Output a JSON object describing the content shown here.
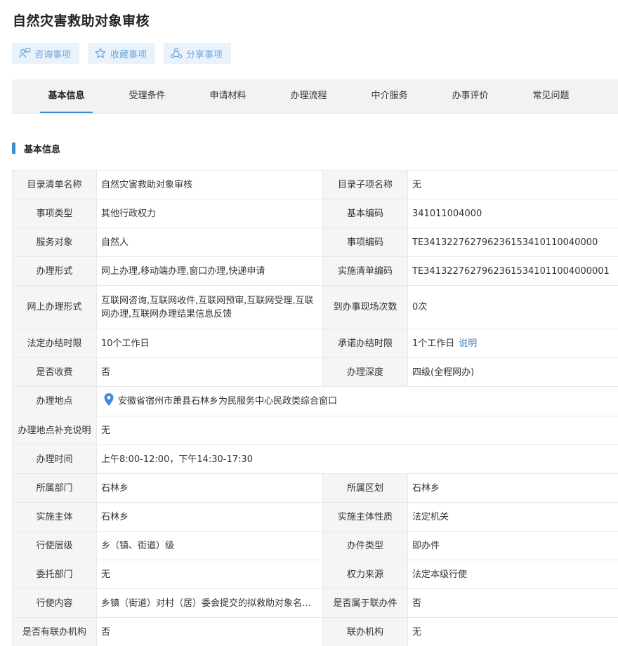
{
  "page": {
    "title": "自然灾害救助对象审核"
  },
  "actions": [
    {
      "label": "咨询事项",
      "icon": "consult-icon"
    },
    {
      "label": "收藏事项",
      "icon": "star-icon"
    },
    {
      "label": "分享事项",
      "icon": "share-icon"
    }
  ],
  "tabs": [
    "基本信息",
    "受理条件",
    "申请材料",
    "办理流程",
    "中介服务",
    "办事评价",
    "常见问题"
  ],
  "active_tab": "基本信息",
  "section": {
    "title": "基本信息"
  },
  "colors": {
    "accent": "#3b8cd8",
    "action_bg": "#eaf3fc",
    "action_text": "#6aa6dd",
    "label_bg": "#f5f5f5",
    "link": "#3b7fc4"
  },
  "rows": [
    {
      "l1": "目录清单名称",
      "v1": "自然灾害救助对象审核",
      "l2": "目录子项名称",
      "v2": "无"
    },
    {
      "l1": "事项类型",
      "v1": "其他行政权力",
      "l2": "基本编码",
      "v2": "341011004000"
    },
    {
      "l1": "服务对象",
      "v1": "自然人",
      "l2": "事项编码",
      "v2": "TE341322762796236153410110040000"
    },
    {
      "l1": "办理形式",
      "v1": "网上办理,移动端办理,窗口办理,快递申请",
      "l2": "实施清单编码",
      "v2": "TE34132276279623615341011004000001"
    },
    {
      "l1": "网上办理形式",
      "v1": "互联网咨询,互联网收件,互联网预审,互联网受理,互联网办理,互联网办理结果信息反馈",
      "l2": "到办事现场次数",
      "v2": "0次"
    },
    {
      "l1": "法定办结时限",
      "v1": "10个工作日",
      "l2": "承诺办结时限",
      "v2": "1个工作日",
      "link": "说明"
    },
    {
      "l1": "是否收费",
      "v1": "否",
      "l2": "办理深度",
      "v2": "四级(全程网办)"
    },
    {
      "l1": "办理地点",
      "v1": "安徽省宿州市萧县石林乡为民服务中心民政类综合窗口"
    },
    {
      "l1": "办理地点补充说明",
      "v1": "无"
    },
    {
      "l1": "办理时间",
      "v1": "上午8:00-12:00，下午14:30-17:30"
    },
    {
      "l1": "所属部门",
      "v1": "石林乡",
      "l2": "所属区划",
      "v2": "石林乡"
    },
    {
      "l1": "实施主体",
      "v1": "石林乡",
      "l2": "实施主体性质",
      "v2": "法定机关"
    },
    {
      "l1": "行使层级",
      "v1": "乡（镇、街道）级",
      "l2": "办件类型",
      "v2": "即办件"
    },
    {
      "l1": "委托部门",
      "v1": "无",
      "l2": "权力来源",
      "v2": "法定本级行使"
    },
    {
      "l1": "行使内容",
      "v1": "乡镇（街道）对村（居）委会提交的拟救助对象名单进行审核",
      "l2": "是否属于联办件",
      "v2": "否"
    },
    {
      "l1": "是否有联办机构",
      "v1": "否",
      "l2": "联办机构",
      "v2": "无"
    }
  ]
}
